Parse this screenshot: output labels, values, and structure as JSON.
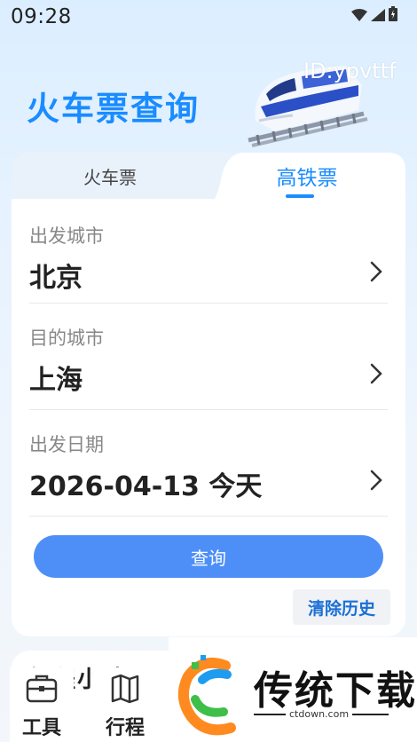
{
  "status_bar": {
    "time": "09:28"
  },
  "header": {
    "title": "火车票查询",
    "id_label": "ID:ypvttf"
  },
  "tabs": [
    {
      "label": "火车票",
      "active": false
    },
    {
      "label": "高铁票",
      "active": true
    }
  ],
  "form": {
    "departure": {
      "label": "出发城市",
      "value": "北京"
    },
    "destination": {
      "label": "目的城市",
      "value": "上海"
    },
    "date": {
      "label": "出发日期",
      "value": "2026-04-13 今天"
    }
  },
  "query_button": "查询",
  "clear_history": "清除历史",
  "secondary_card_title": "行程小助",
  "bottom_nav": [
    {
      "label": "工具",
      "icon": "toolbox-icon"
    },
    {
      "label": "行程",
      "icon": "map-icon"
    }
  ],
  "watermark_logo": {
    "text": "传统下载",
    "sub": "ctdown.com"
  },
  "colors": {
    "accent": "#1a8cff",
    "button": "#4d8ff7"
  }
}
